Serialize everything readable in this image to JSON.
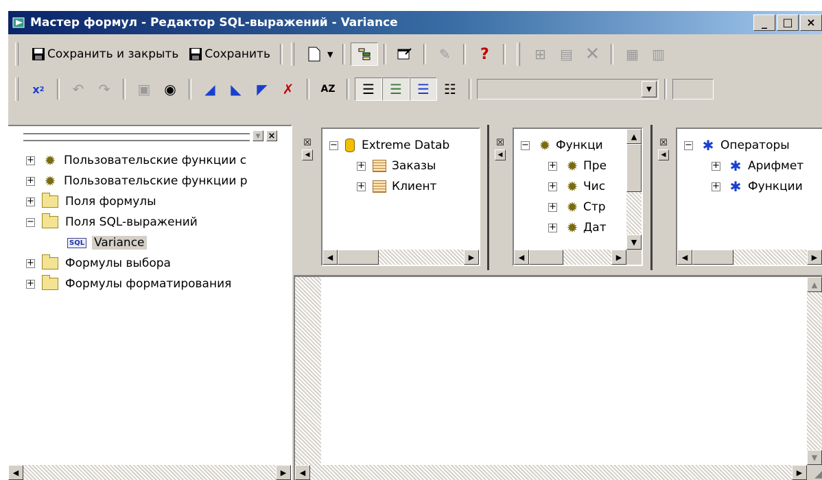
{
  "window": {
    "title": "Мастер формул - Редактор SQL-выражений - Variance",
    "minimize": "_",
    "maximize": "□",
    "close": "×"
  },
  "toolbar1": {
    "save_close_label": "Сохранить и закрыть",
    "save_label": "Сохранить",
    "help_glyph": "?"
  },
  "left_tree": {
    "items": [
      {
        "label": "Пользовательские функции с",
        "expander": "+",
        "icon": "gear-icon"
      },
      {
        "label": "Пользовательские функции р",
        "expander": "+",
        "icon": "gear-icon"
      },
      {
        "label": "Поля формулы",
        "expander": "+",
        "icon": "folder-icon"
      },
      {
        "label": "Поля SQL-выражений",
        "expander": "−",
        "icon": "folder-icon"
      },
      {
        "label": "Variance",
        "icon": "sql-icon",
        "selected": true
      },
      {
        "label": "Формулы выбора",
        "expander": "+",
        "icon": "folder-icon"
      },
      {
        "label": "Формулы форматирования",
        "expander": "+",
        "icon": "folder-icon"
      }
    ]
  },
  "fields_tree": {
    "root": "Extreme Datab",
    "children": [
      "Заказы",
      "Клиент"
    ]
  },
  "functions_tree": {
    "root": "Функци",
    "children": [
      "Пре",
      "Чис",
      "Стр",
      "Дат"
    ]
  },
  "operators_tree": {
    "root": "Операторы",
    "children": [
      "Арифмет",
      "Функции"
    ]
  },
  "sql_icon_text": "SQL",
  "colors": {
    "title_start": "#0a246a",
    "title_end": "#a6caf0",
    "face": "#d4d0c8"
  }
}
